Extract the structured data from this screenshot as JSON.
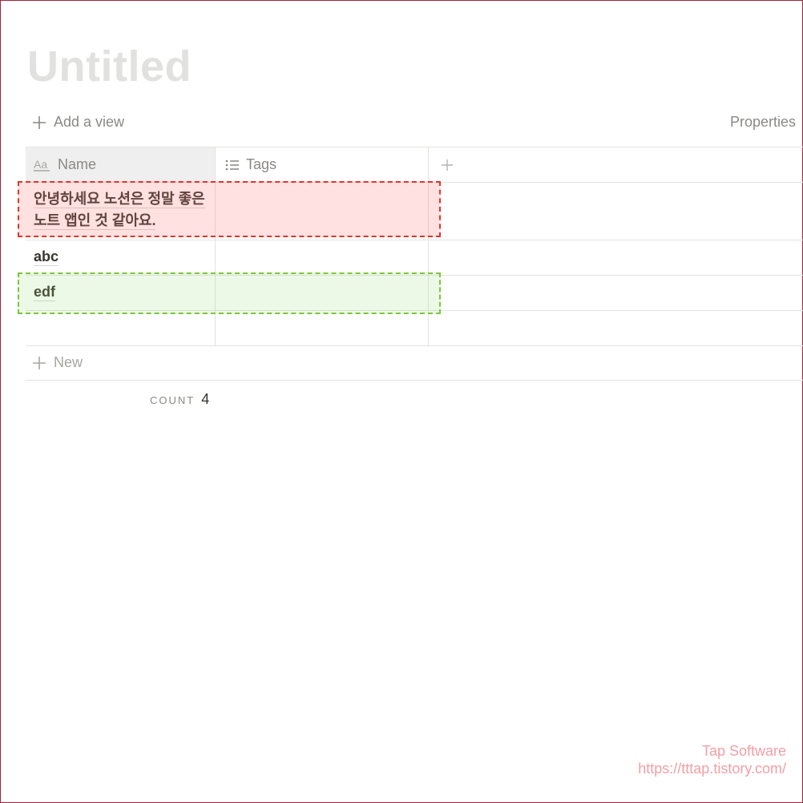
{
  "page": {
    "title": "Untitled"
  },
  "toolbar": {
    "add_view_label": "Add a view",
    "properties_label": "Properties"
  },
  "table": {
    "columns": [
      {
        "label": "Name",
        "icon": "text-type-icon"
      },
      {
        "label": "Tags",
        "icon": "list-icon"
      }
    ],
    "add_column_icon": "plus-icon",
    "rows": [
      {
        "name_line1": "안녕하세요 노션은 정말 좋은",
        "name_line2": "노트 앱인 것 같아요."
      },
      {
        "name": "abc"
      },
      {
        "name": "edf"
      },
      {
        "name": ""
      }
    ],
    "new_label": "New",
    "count_label": "COUNT",
    "count_value": "4"
  },
  "watermark": {
    "line1": "Tap Software",
    "line2": "https://tttap.tistory.com/"
  },
  "colors": {
    "frame": "#a3233a",
    "highlight_red": "#e0352b",
    "highlight_green": "#7cc63b",
    "text": "#37352f",
    "muted": "#8a8985"
  }
}
